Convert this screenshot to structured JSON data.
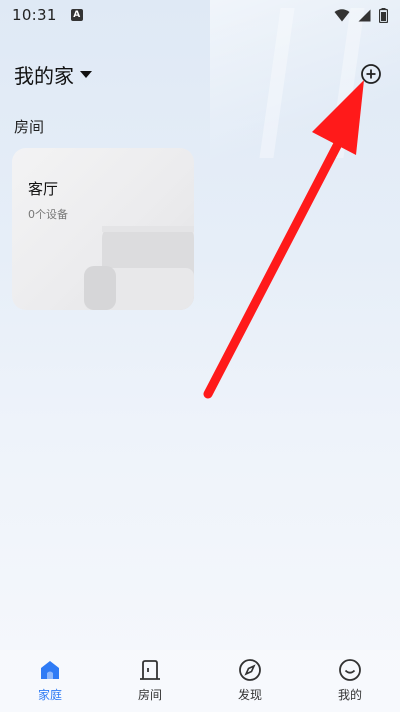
{
  "status_bar": {
    "time": "10:31",
    "notification_glyph": "A",
    "icons": [
      "wifi-icon",
      "signal-icon",
      "battery-icon"
    ]
  },
  "header": {
    "home_name": "我的家",
    "add_icon": "plus-circle-icon"
  },
  "section": {
    "rooms_label": "房间"
  },
  "rooms": [
    {
      "name": "客厅",
      "device_count": "0个设备"
    }
  ],
  "annotation": {
    "color": "#ff1a1a",
    "points_to": "add-button"
  },
  "nav": {
    "active_color": "#2f7bf5",
    "items": [
      {
        "label": "家庭",
        "icon": "home-icon",
        "active": true
      },
      {
        "label": "房间",
        "icon": "door-icon",
        "active": false
      },
      {
        "label": "发现",
        "icon": "compass-icon",
        "active": false
      },
      {
        "label": "我的",
        "icon": "smile-icon",
        "active": false
      }
    ]
  }
}
